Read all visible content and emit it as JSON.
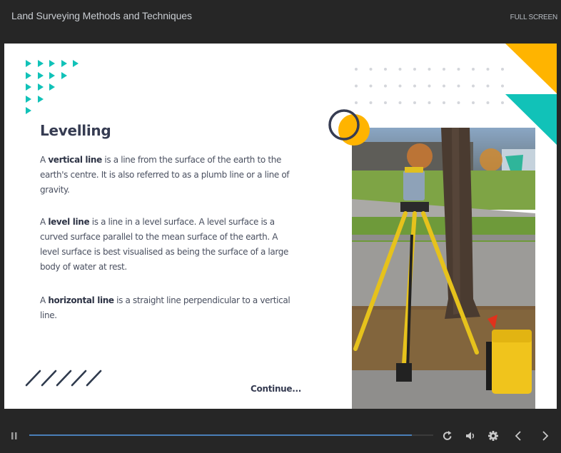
{
  "header": {
    "course_title": "Land Surveying Methods and Techniques",
    "fullscreen_label": "FULL SCREEN"
  },
  "slide": {
    "heading": "Levelling",
    "paragraphs": [
      {
        "prefix": "A ",
        "term": "vertical line",
        "text": " is a line from the surface of the earth to the earth's centre. It is also referred to as a plumb line or a line of gravity."
      },
      {
        "prefix": "A ",
        "term": "level line",
        "text": " is a line in a level surface. A level surface is a curved surface parallel to the mean surface of the earth. A level surface is best visualised as being the surface of a large body of water at rest."
      },
      {
        "prefix": "A ",
        "term": "horizontal line",
        "text": " is a straight line perpendicular to a vertical line."
      }
    ],
    "continue_label": "Continue...",
    "image_subject": "total-station surveying instrument on yellow tripod beside tree with yellow case",
    "colors": {
      "teal": "#11c2b8",
      "yellow": "#ffb400",
      "navy": "#363c52"
    }
  },
  "player": {
    "progress_fraction": 0.947,
    "icons": [
      "pause-icon",
      "replay-icon",
      "volume-icon",
      "settings-icon",
      "prev-icon",
      "next-icon"
    ],
    "progress_color": "#4a7fb8"
  }
}
